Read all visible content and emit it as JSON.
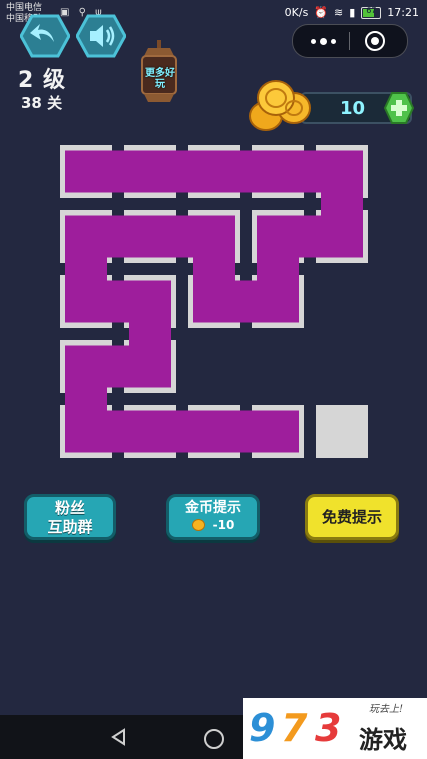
{
  "status_bar": {
    "carrier_1": "中国电信",
    "carrier_2": "中国移动",
    "speed": "0K/s",
    "battery": "67",
    "time": "17:21"
  },
  "top_buttons": {
    "back_icon": "back-arrow-icon",
    "sound_icon": "speaker-icon"
  },
  "capsule": {
    "more_icon": "ellipsis-icon",
    "close_icon": "target-close-icon"
  },
  "level": {
    "level_label": "2 级",
    "stage_label": "38 关"
  },
  "more_games": {
    "label": "更多好玩"
  },
  "coins": {
    "count": "10",
    "plus_icon": "plus-icon",
    "pile_icon": "coin-pile-icon"
  },
  "board": {
    "rows": 5,
    "cols": 5,
    "cells": [
      [
        1,
        1,
        1,
        1,
        1
      ],
      [
        1,
        1,
        1,
        1,
        1
      ],
      [
        1,
        1,
        1,
        1,
        0
      ],
      [
        1,
        1,
        0,
        0,
        0
      ],
      [
        1,
        1,
        1,
        1,
        1
      ]
    ],
    "path": [
      [
        4,
        3
      ],
      [
        4,
        2
      ],
      [
        4,
        1
      ],
      [
        4,
        0
      ],
      [
        3,
        0
      ],
      [
        3,
        1
      ],
      [
        2,
        1
      ],
      [
        2,
        0
      ],
      [
        1,
        0
      ],
      [
        1,
        1
      ],
      [
        1,
        2
      ],
      [
        2,
        2
      ],
      [
        2,
        3
      ],
      [
        1,
        3
      ],
      [
        1,
        4
      ],
      [
        0,
        4
      ],
      [
        0,
        3
      ],
      [
        0,
        2
      ],
      [
        0,
        1
      ],
      [
        0,
        0
      ]
    ],
    "empty_cell": [
      4,
      4
    ],
    "path_color": "#9e1e9c",
    "empty_color": "#d6d6d6"
  },
  "buttons": {
    "fans_line1": "粉丝",
    "fans_line2": "互助群",
    "coin_hint_title": "金币提示",
    "coin_hint_cost": "-10",
    "free_hint": "免费提示"
  },
  "navbar": {
    "back_icon": "triangle-back-icon",
    "home_icon": "circle-home-icon"
  },
  "watermark": {
    "digit_1": "9",
    "digit_2": "7",
    "digit_3": "3",
    "text": "游戏",
    "slogan": "玩去上!"
  }
}
